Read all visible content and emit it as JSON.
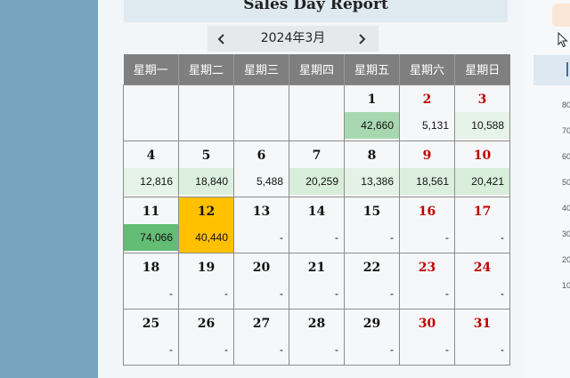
{
  "report": {
    "title": "Sales Day Report"
  },
  "nav": {
    "month_label": "2024年3月"
  },
  "calendar": {
    "weekdays": [
      "星期一",
      "星期二",
      "星期三",
      "星期四",
      "星期五",
      "星期六",
      "星期日"
    ],
    "weeks": [
      [
        null,
        null,
        null,
        null,
        {
          "day": "1",
          "value": "42,660",
          "color": "#a8d8b0"
        },
        {
          "day": "2",
          "value": "5,131",
          "color": "#f6f7f8"
        },
        {
          "day": "3",
          "value": "10,588",
          "color": "#e6f3e8"
        }
      ],
      [
        {
          "day": "4",
          "value": "12,816",
          "color": "#e6f3e8"
        },
        {
          "day": "5",
          "value": "18,840",
          "color": "#dcefdf"
        },
        {
          "day": "6",
          "value": "5,488",
          "color": "#f6f7f8"
        },
        {
          "day": "7",
          "value": "20,259",
          "color": "#d8eedb"
        },
        {
          "day": "8",
          "value": "13,386",
          "color": "#e4f2e6"
        },
        {
          "day": "9",
          "value": "18,561",
          "color": "#dcefdf"
        },
        {
          "day": "10",
          "value": "20,421",
          "color": "#d8eedb"
        }
      ],
      [
        {
          "day": "11",
          "value": "74,066",
          "color": "#63bd74"
        },
        {
          "day": "12",
          "value": "40,440",
          "color": "#ffc000"
        },
        {
          "day": "13",
          "value": "-",
          "color": "#f6f7f8"
        },
        {
          "day": "14",
          "value": "-",
          "color": "#f6f7f8"
        },
        {
          "day": "15",
          "value": "-",
          "color": "#f6f7f8"
        },
        {
          "day": "16",
          "value": "-",
          "color": "#f6f7f8"
        },
        {
          "day": "17",
          "value": "-",
          "color": "#f6f7f8"
        }
      ],
      [
        {
          "day": "18",
          "value": "-",
          "color": "#f6f7f8"
        },
        {
          "day": "19",
          "value": "-",
          "color": "#f6f7f8"
        },
        {
          "day": "20",
          "value": "-",
          "color": "#f6f7f8"
        },
        {
          "day": "21",
          "value": "-",
          "color": "#f6f7f8"
        },
        {
          "day": "22",
          "value": "-",
          "color": "#f6f7f8"
        },
        {
          "day": "23",
          "value": "-",
          "color": "#f6f7f8"
        },
        {
          "day": "24",
          "value": "-",
          "color": "#f6f7f8"
        }
      ],
      [
        {
          "day": "25",
          "value": "-",
          "color": "#f6f7f8"
        },
        {
          "day": "26",
          "value": "-",
          "color": "#f6f7f8"
        },
        {
          "day": "27",
          "value": "-",
          "color": "#f6f7f8"
        },
        {
          "day": "28",
          "value": "-",
          "color": "#f6f7f8"
        },
        {
          "day": "29",
          "value": "-",
          "color": "#f6f7f8"
        },
        {
          "day": "30",
          "value": "-",
          "color": "#f6f7f8"
        },
        {
          "day": "31",
          "value": "-",
          "color": "#f6f7f8"
        }
      ]
    ]
  },
  "right_axis": {
    "ticks": [
      "80",
      "70",
      "60",
      "50",
      "40",
      "30",
      "20",
      "10"
    ]
  },
  "colors": {
    "weekend": "#c00000",
    "header_bg": "#7f7f7f",
    "highlight": "#ffc000"
  }
}
